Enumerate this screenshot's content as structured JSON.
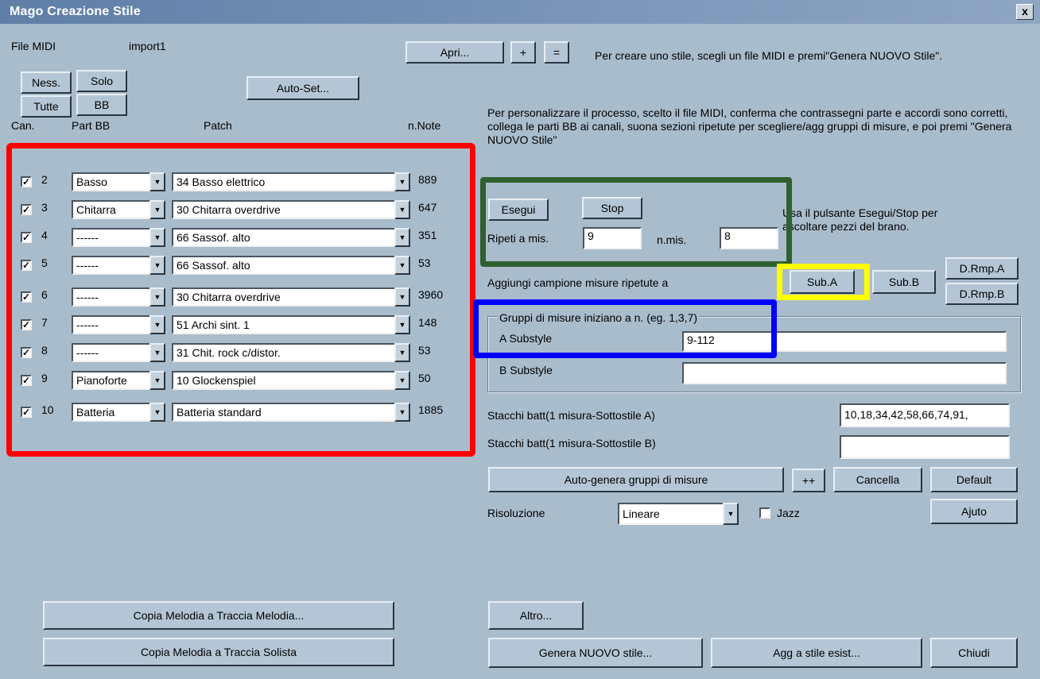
{
  "window": {
    "title": "Mago Creazione Stile",
    "close_label": "x"
  },
  "top": {
    "file_midi_label": "File MIDI",
    "file_name": "import1",
    "open_button": "Apri...",
    "plus_button": "+",
    "equal_button": "=",
    "intro_text": "Per creare uno stile, scegli un file MIDI e premi\"Genera NUOVO Stile\".",
    "info_text": "Per personalizzare il processo, scelto il file MIDI, conferma che contrassegni parte e accordi sono corretti, collega le parti BB ai canali, suona sezioni ripetute per scegliere/agg gruppi di misure, e poi premi \"Genera NUOVO Stile\""
  },
  "select_buttons": {
    "none": "Ness.",
    "solo": "Solo",
    "all": "Tutte",
    "bb": "BB",
    "auto_set": "Auto-Set..."
  },
  "columns": {
    "channel": "Can.",
    "part_bb": "Part BB",
    "patch": "Patch",
    "notes": "n.Note"
  },
  "channels": [
    {
      "checked": true,
      "channel": "2",
      "part": "Basso",
      "patch": "34 Basso elettrico",
      "notes": "889"
    },
    {
      "checked": true,
      "channel": "3",
      "part": "Chitarra",
      "patch": "30 Chitarra overdrive",
      "notes": "647"
    },
    {
      "checked": true,
      "channel": "4",
      "part": "------",
      "patch": "66 Sassof. alto",
      "notes": "351"
    },
    {
      "checked": true,
      "channel": "5",
      "part": "------",
      "patch": "66 Sassof. alto",
      "notes": "53"
    },
    {
      "checked": true,
      "channel": "6",
      "part": "------",
      "patch": "30 Chitarra overdrive",
      "notes": "3960"
    },
    {
      "checked": true,
      "channel": "7",
      "part": "------",
      "patch": "51 Archi sint. 1",
      "notes": "148"
    },
    {
      "checked": true,
      "channel": "8",
      "part": "------",
      "patch": "31 Chit. rock c/distor.",
      "notes": "53"
    },
    {
      "checked": true,
      "channel": "9",
      "part": "Pianoforte",
      "patch": "10 Glockenspiel",
      "notes": "50"
    },
    {
      "checked": true,
      "channel": "10",
      "part": "Batteria",
      "patch": "Batteria standard",
      "notes": "1885"
    }
  ],
  "playback": {
    "play_button": "Esegui",
    "stop_button": "Stop",
    "repeat_label": "Ripeti a mis.",
    "repeat_value": "9",
    "bars_label": "n.mis.",
    "bars_value": "8",
    "hint": "Usa il pulsante Esegui/Stop per ascoltare pezzi del brano."
  },
  "substyle_add": {
    "label": "Aggiungi campione misure ripetute a",
    "sub_a": "Sub.A",
    "sub_b": "Sub.B",
    "drmp_a": "D.Rmp.A",
    "drmp_b": "D.Rmp.B"
  },
  "groups": {
    "caption": "Gruppi di misure iniziano a n. (eg. 1,3,7)",
    "a_label": "A Substyle",
    "a_value": "9-112",
    "b_label": "B Substyle",
    "b_value": ""
  },
  "drum_breaks": {
    "a_label": "Stacchi batt(1 misura-Sottostile A)",
    "a_value": "10,18,34,42,58,66,74,91,",
    "b_label": "Stacchi batt(1 misura-Sottostile B)",
    "b_value": ""
  },
  "actions": {
    "auto_generate": "Auto-genera gruppi di misure",
    "plusplus": "++",
    "cancel": "Cancella",
    "default": "Default",
    "resolution_label": "Risoluzione",
    "resolution_value": "Lineare",
    "jazz_label": "Jazz",
    "jazz_checked": false,
    "help": "Ajuto",
    "other": "Altro...",
    "copy_melody": "Copia Melodia a Traccia Melodia...",
    "copy_solo": "Copia Melodia a Traccia Solista",
    "generate_new": "Genera NUOVO stile...",
    "add_existing": "Agg a stile esist...",
    "close": "Chiudi"
  },
  "colors": {
    "window_bg": "#a9bccc",
    "highlight_red": "#ff0000",
    "highlight_green": "#2f6030",
    "highlight_yellow": "#ffff00",
    "highlight_blue": "#0000ff"
  },
  "icons": {
    "dropdown": "chevron-down-icon",
    "checkbox": "check-icon"
  }
}
